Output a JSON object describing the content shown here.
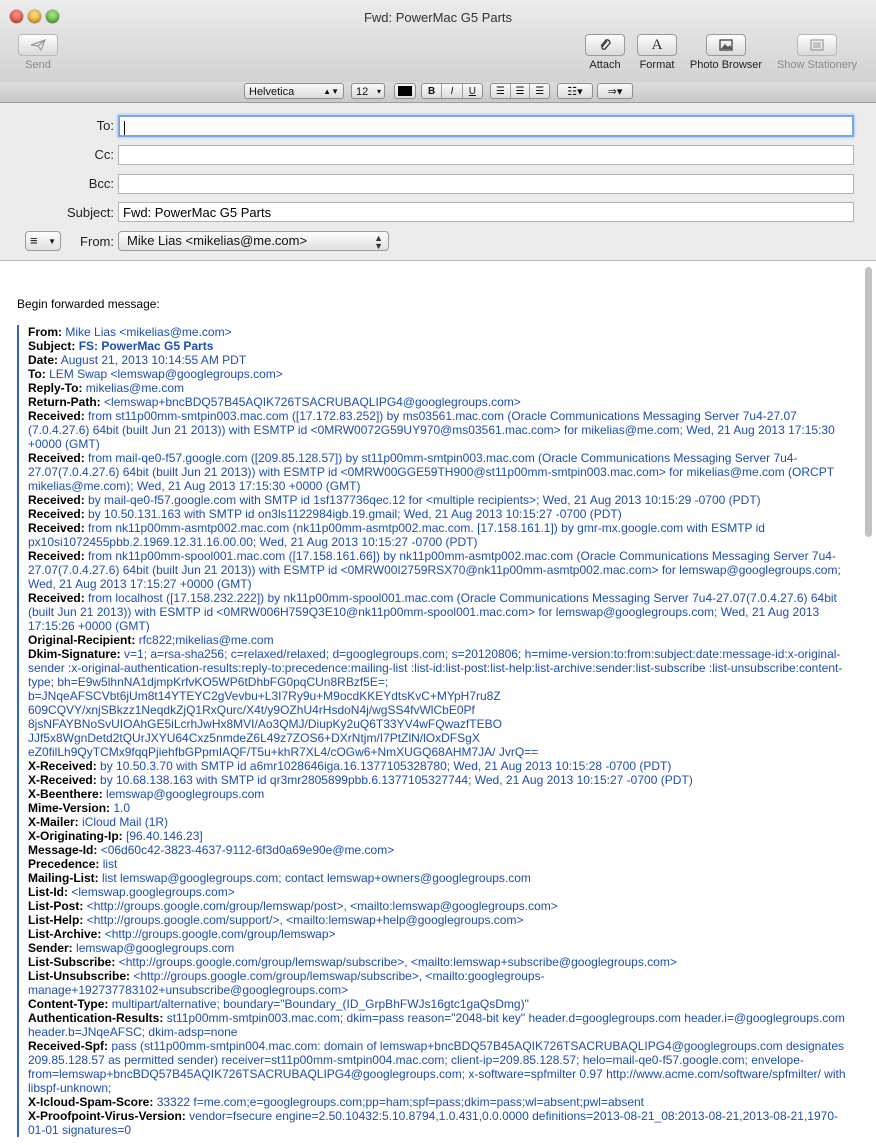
{
  "window": {
    "title": "Fwd: PowerMac G5 Parts"
  },
  "toolbar": {
    "send": "Send",
    "attach": "Attach",
    "format": "Format",
    "photo_browser": "Photo Browser",
    "show_stationery": "Show Stationery"
  },
  "format_bar": {
    "font": "Helvetica",
    "size": "12",
    "bold": "B",
    "italic": "I",
    "underline": "U"
  },
  "headers": {
    "to_label": "To:",
    "to_value": "",
    "cc_label": "Cc:",
    "cc_value": "",
    "bcc_label": "Bcc:",
    "bcc_value": "",
    "subject_label": "Subject:",
    "subject_value": "Fwd: PowerMac G5 Parts",
    "from_label": "From:",
    "from_value": "Mike Lias <mikelias@me.com>"
  },
  "body": {
    "intro": "Begin forwarded message:",
    "headers": [
      {
        "key": "From:",
        "value": "Mike Lias <mikelias@me.com>"
      },
      {
        "key": "Subject:",
        "value": "FS: PowerMac G5 Parts"
      },
      {
        "key": "Date:",
        "value": "August 21, 2013 10:14:55 AM PDT"
      },
      {
        "key": "To:",
        "value": "LEM Swap <lemswap@googlegroups.com>"
      },
      {
        "key": "Reply-To:",
        "value": "mikelias@me.com"
      },
      {
        "key": "Return-Path:",
        "value": "<lemswap+bncBDQ57B45AQIK726TSACRUBAQLIPG4@googlegroups.com>"
      },
      {
        "key": "Received:",
        "value": "from st11p00mm-smtpin003.mac.com ([17.172.83.252]) by ms03561.mac.com (Oracle Communications Messaging Server 7u4-27.07 (7.0.4.27.6) 64bit (built Jun 21 2013)) with ESMTP id <0MRW0072G59UY970@ms03561.mac.com> for mikelias@me.com; Wed, 21 Aug 2013 17:15:30 +0000 (GMT)"
      },
      {
        "key": "Received:",
        "value": "from mail-qe0-f57.google.com ([209.85.128.57]) by st11p00mm-smtpin003.mac.com (Oracle Communications Messaging Server 7u4-27.07(7.0.4.27.6) 64bit (built Jun 21 2013)) with ESMTP id <0MRW00GGE59TH900@st11p00mm-smtpin003.mac.com> for mikelias@me.com (ORCPT mikelias@me.com); Wed, 21 Aug 2013 17:15:30 +0000 (GMT)"
      },
      {
        "key": "Received:",
        "value": "by mail-qe0-f57.google.com with SMTP id 1sf137736qec.12 for <multiple recipients>; Wed, 21 Aug 2013 10:15:29 -0700 (PDT)"
      },
      {
        "key": "Received:",
        "value": "by 10.50.131.163 with SMTP id on3ls1122984igb.19.gmail; Wed, 21 Aug 2013 10:15:27 -0700 (PDT)"
      },
      {
        "key": "Received:",
        "value": "from nk11p00mm-asmtp002.mac.com (nk11p00mm-asmtp002.mac.com. [17.158.161.1]) by gmr-mx.google.com with ESMTP id px10si1072455pbb.2.1969.12.31.16.00.00; Wed, 21 Aug 2013 10:15:27 -0700 (PDT)"
      },
      {
        "key": "Received:",
        "value": "from nk11p00mm-spool001.mac.com ([17.158.161.66]) by nk11p00mm-asmtp002.mac.com (Oracle Communications Messaging Server 7u4-27.07(7.0.4.27.6) 64bit (built Jun 21 2013)) with ESMTP id <0MRW00I2759RSX70@nk11p00mm-asmtp002.mac.com> for lemswap@googlegroups.com; Wed, 21 Aug 2013 17:15:27 +0000 (GMT)"
      },
      {
        "key": "Received:",
        "value": "from localhost ([17.158.232.222]) by nk11p00mm-spool001.mac.com (Oracle Communications Messaging Server 7u4-27.07(7.0.4.27.6) 64bit (built Jun 21 2013)) with ESMTP id <0MRW006H759Q3E10@nk11p00mm-spool001.mac.com> for lemswap@googlegroups.com; Wed, 21 Aug 2013 17:15:26 +0000 (GMT)"
      },
      {
        "key": "Original-Recipient:",
        "value": "rfc822;mikelias@me.com"
      },
      {
        "key": "Dkim-Signature:",
        "value": "v=1; a=rsa-sha256; c=relaxed/relaxed; d=googlegroups.com; s=20120806; h=mime-version:to:from:subject:date:message-id:x-original-sender :x-original-authentication-results:reply-to:precedence:mailing-list :list-id:list-post:list-help:list-archive:sender:list-subscribe :list-unsubscribe:content-type; bh=E9w5lhnNA1djmpKrfvKO5WP6tDhbFG0pqCUn8RBzf5E=; b=JNqeAFSCVbt6jUm8t14YTEYC2gVevbu+L3I7Ry9u+M9ocdKKEYdtsKvC+MYpH7ru8Z 609CQVY/xnjSBkzz1NeqdkZjQ1RxQurc/X4t/y9OZhU4rHsdoN4j/wgSS4fvWlCbE0Pf 8jsNFAYBNoSvUIOAhGE5iLcrhJwHx8MVI/Ao3QMJ/DiupKy2uQ6T33YV4wFQwazfTEBO JJf5x8WgnDetd2tQUrJXYU64Cxz5nmdeZ6L49z7ZOS6+DXrNtjm/I7PtZlN/lOxDFSgX eZ0filLh9QyTCMx9fqqPjiehfbGPpmIAQF/T5u+khR7XL4/cOGw6+NmXUGQ68AHM7JA/ JvrQ=="
      },
      {
        "key": "X-Received:",
        "value": "by 10.50.3.70 with SMTP id a6mr1028646iga.16.1377105328780; Wed, 21 Aug 2013 10:15:28 -0700 (PDT)"
      },
      {
        "key": "X-Received:",
        "value": "by 10.68.138.163 with SMTP id qr3mr2805899pbb.6.1377105327744; Wed, 21 Aug 2013 10:15:27 -0700 (PDT)"
      },
      {
        "key": "X-Beenthere:",
        "value": "lemswap@googlegroups.com"
      },
      {
        "key": "Mime-Version:",
        "value": "1.0"
      },
      {
        "key": "X-Mailer:",
        "value": "iCloud Mail (1R)"
      },
      {
        "key": "X-Originating-Ip:",
        "value": "[96.40.146.23]"
      },
      {
        "key": "Message-Id:",
        "value": "<06d60c42-3823-4637-9112-6f3d0a69e90e@me.com>"
      },
      {
        "key": "Precedence:",
        "value": "list"
      },
      {
        "key": "Mailing-List:",
        "value": "list lemswap@googlegroups.com; contact lemswap+owners@googlegroups.com"
      },
      {
        "key": "List-Id:",
        "value": "<lemswap.googlegroups.com>"
      },
      {
        "key": "List-Post:",
        "value": "<http://groups.google.com/group/lemswap/post>, <mailto:lemswap@googlegroups.com>"
      },
      {
        "key": "List-Help:",
        "value": "<http://groups.google.com/support/>, <mailto:lemswap+help@googlegroups.com>"
      },
      {
        "key": "List-Archive:",
        "value": "<http://groups.google.com/group/lemswap>"
      },
      {
        "key": "Sender:",
        "value": "lemswap@googlegroups.com"
      },
      {
        "key": "List-Subscribe:",
        "value": "<http://groups.google.com/group/lemswap/subscribe>, <mailto:lemswap+subscribe@googlegroups.com>"
      },
      {
        "key": "List-Unsubscribe:",
        "value": "<http://groups.google.com/group/lemswap/subscribe>, <mailto:googlegroups-manage+192737783102+unsubscribe@googlegroups.com>"
      },
      {
        "key": "Content-Type:",
        "value": "multipart/alternative; boundary=\"Boundary_(ID_GrpBhFWJs16gtc1gaQsDmg)\""
      },
      {
        "key": "Authentication-Results:",
        "value": "st11p00mm-smtpin003.mac.com; dkim=pass reason=\"2048-bit key\" header.d=googlegroups.com header.i=@googlegroups.com header.b=JNqeAFSC; dkim-adsp=none"
      },
      {
        "key": "Received-Spf:",
        "value": "pass (st11p00mm-smtpin004.mac.com: domain of lemswap+bncBDQ57B45AQIK726TSACRUBAQLIPG4@googlegroups.com designates 209.85.128.57 as permitted sender) receiver=st11p00mm-smtpin004.mac.com; client-ip=209.85.128.57; helo=mail-qe0-f57.google.com; envelope-from=lemswap+bncBDQ57B45AQIK726TSACRUBAQLIPG4@googlegroups.com; x-software=spfmilter 0.97 http://www.acme.com/software/spfmilter/ with libspf-unknown;"
      },
      {
        "key": "X-Icloud-Spam-Score:",
        "value": "33322 f=me.com;e=googlegroups.com;pp=ham;spf=pass;dkim=pass;wl=absent;pwl=absent"
      },
      {
        "key": "X-Proofpoint-Virus-Version:",
        "value": "vendor=fsecure engine=2.50.10432:5.10.8794,1.0.431,0.0.0000 definitions=2013-08-21_08:2013-08-21,2013-08-21,1970-01-01 signatures=0"
      }
    ]
  }
}
